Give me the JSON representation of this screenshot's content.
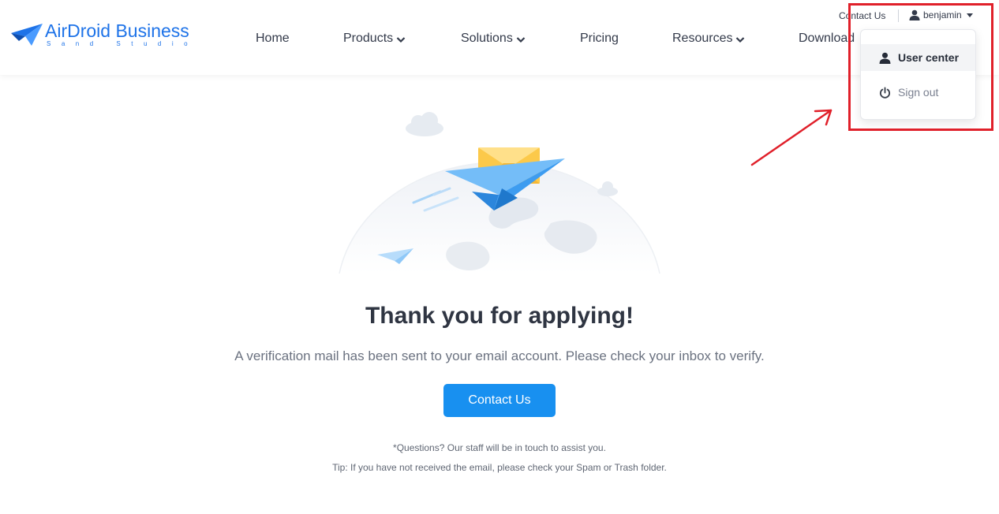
{
  "logo": {
    "name": "AirDroid Business",
    "subtitle": "Sand Studio"
  },
  "nav": {
    "items": [
      {
        "label": "Home",
        "has_dropdown": false
      },
      {
        "label": "Products",
        "has_dropdown": true
      },
      {
        "label": "Solutions",
        "has_dropdown": true
      },
      {
        "label": "Pricing",
        "has_dropdown": false
      },
      {
        "label": "Resources",
        "has_dropdown": true
      },
      {
        "label": "Download",
        "has_dropdown": false
      }
    ]
  },
  "topbar": {
    "contact_label": "Contact Us",
    "username": "benjamin"
  },
  "user_dropdown": {
    "items": [
      {
        "label": "User center",
        "icon": "user-icon",
        "highlighted": true
      },
      {
        "label": "Sign out",
        "icon": "power-icon",
        "highlighted": false
      }
    ]
  },
  "main": {
    "title": "Thank you for applying!",
    "message": "A verification mail has been sent to your email account. Please check your inbox to verify.",
    "contact_button": "Contact Us",
    "note_questions": "*Questions? Our staff will be in touch to assist you.",
    "note_tip": "Tip: If you have not received the email, please check your Spam or Trash folder."
  },
  "colors": {
    "brand": "#1e73e8",
    "button": "#1890f0",
    "annotation": "#e0202a",
    "title": "#2f3542"
  }
}
